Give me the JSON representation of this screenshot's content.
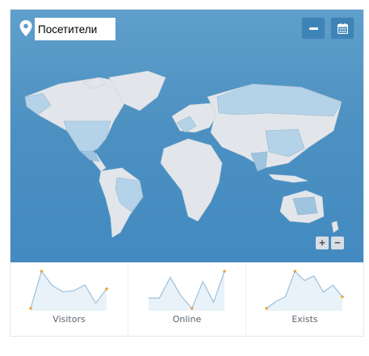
{
  "widget": {
    "title_value": "Посетители",
    "icons": {
      "location": "map-pin-icon",
      "minimize": "minus-icon",
      "calendar": "calendar-icon"
    },
    "zoom": {
      "in_label": "+",
      "out_label": "−"
    }
  },
  "colors": {
    "ocean": "#4d91c2",
    "land_default": "#e2e6ea",
    "land_light": "#b4d2e8",
    "land_highlight": "#9fc4e0",
    "sparkline_stroke": "#9bc0dd",
    "sparkline_fill": "#e9f2f9",
    "marker": "#f0a33d"
  },
  "stats": [
    {
      "label": "Visitors",
      "values": [
        5,
        95,
        60,
        45,
        48,
        62,
        18,
        52
      ]
    },
    {
      "label": "Online",
      "values": [
        30,
        30,
        80,
        35,
        5,
        70,
        20,
        95
      ]
    },
    {
      "label": "Exists",
      "values": [
        5,
        20,
        30,
        85,
        65,
        75,
        40,
        55,
        30
      ]
    }
  ]
}
